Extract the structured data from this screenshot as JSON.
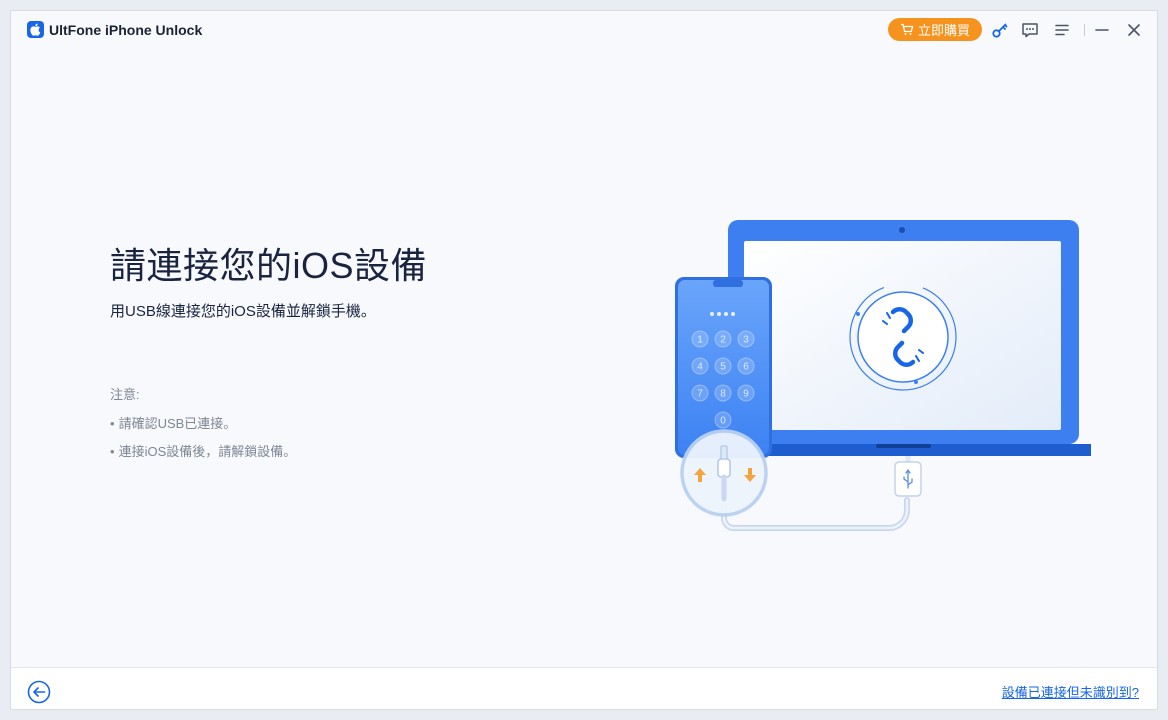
{
  "app": {
    "title": "UltFone iPhone Unlock",
    "logo_icon": "apple-icon",
    "accent_color": "#1766e8",
    "buy_color": "#f5931e"
  },
  "toolbar": {
    "buy_label": "立即購買",
    "buy_icon": "cart-icon",
    "icons": [
      "key-icon",
      "feedback-icon",
      "menu-icon",
      "minimize-icon",
      "close-icon"
    ]
  },
  "main": {
    "heading": "請連接您的iOS設備",
    "subheading": "用USB線連接您的iOS設備並解鎖手機。",
    "notes_title": "注意:",
    "notes": [
      "請確認USB已連接。",
      "連接iOS設備後，請解鎖設備。"
    ]
  },
  "illustration": {
    "keypad": [
      "1",
      "2",
      "3",
      "4",
      "5",
      "6",
      "7",
      "8",
      "9",
      "0"
    ],
    "center_icon": "broken-link-icon",
    "usb_icon": "usb-icon"
  },
  "footer": {
    "back_icon": "back-arrow-icon",
    "help_link": "設備已連接但未識別到?"
  }
}
